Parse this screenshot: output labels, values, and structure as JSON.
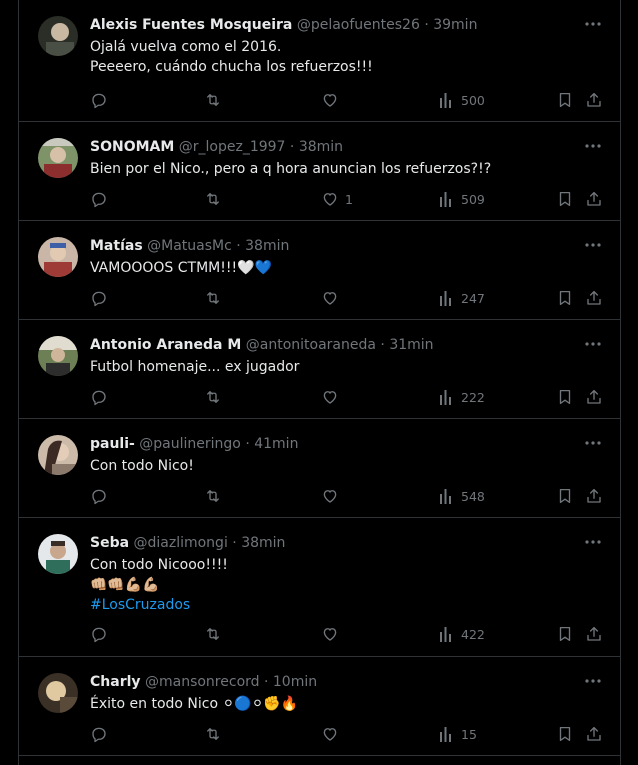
{
  "tweets": [
    {
      "name": "Alexis Fuentes Mosqueira",
      "handle": "@pelaofuentes26",
      "time": "39min",
      "lines": [
        "Ojalá vuelva como el 2016.",
        "Peeeero, cuándo chucha los refuerzos!!!"
      ],
      "likes": "",
      "views": "500",
      "avatar_colors": [
        "#3a3f36",
        "#c9b8a2"
      ]
    },
    {
      "name": "SONOMAM",
      "handle": "@r_lopez_1997",
      "time": "38min",
      "lines": [
        "Bien por el Nico., pero a q hora anuncian los refuerzos?!?"
      ],
      "likes": "1",
      "views": "509",
      "avatar_colors": [
        "#6a7d5a",
        "#8c2e2e"
      ]
    },
    {
      "name": "Matías",
      "handle": "@MatuasMc",
      "time": "38min",
      "lines": [
        "VAMOOOOS CTMM!!!🤍💙"
      ],
      "likes": "",
      "views": "247",
      "avatar_colors": [
        "#9e3b36",
        "#d7c7b8"
      ]
    },
    {
      "name": "Antonio Araneda M",
      "handle": "@antonitoaraneda",
      "time": "31min",
      "lines": [
        "Futbol homenaje... ex jugador"
      ],
      "likes": "",
      "views": "222",
      "avatar_colors": [
        "#5d6d4a",
        "#d9d2c2"
      ]
    },
    {
      "name": "pauli-",
      "handle": "@paulineringo",
      "time": "41min",
      "lines": [
        "Con todo Nico!"
      ],
      "likes": "",
      "views": "548",
      "avatar_colors": [
        "#b9a18e",
        "#3b2b24"
      ]
    },
    {
      "name": "Seba",
      "handle": "@diazlimongi",
      "time": "38min",
      "lines": [
        "Con todo Nicooo!!!!",
        "👊🏼👊🏼💪🏼💪🏼"
      ],
      "hashtag": "#LosCruzados",
      "likes": "",
      "views": "422",
      "avatar_colors": [
        "#d8dde0",
        "#2f6e5b"
      ]
    },
    {
      "name": "Charly",
      "handle": "@mansonrecord",
      "time": "10min",
      "lines": [
        "Éxito en todo Nico ⚪🔵⚪✊🔥"
      ],
      "likes": "",
      "views": "15",
      "avatar_colors": [
        "#3a3025",
        "#e0c9a0"
      ]
    }
  ],
  "icons": {
    "more": "more-icon",
    "reply": "reply-icon",
    "retweet": "retweet-icon",
    "like": "heart-icon",
    "views": "views-icon",
    "bookmark": "bookmark-icon",
    "share": "share-icon"
  },
  "colors": {
    "background": "#000000",
    "text": "#e7e9ea",
    "muted": "#71767b",
    "border": "#2f3336",
    "link": "#1d9bf0"
  }
}
